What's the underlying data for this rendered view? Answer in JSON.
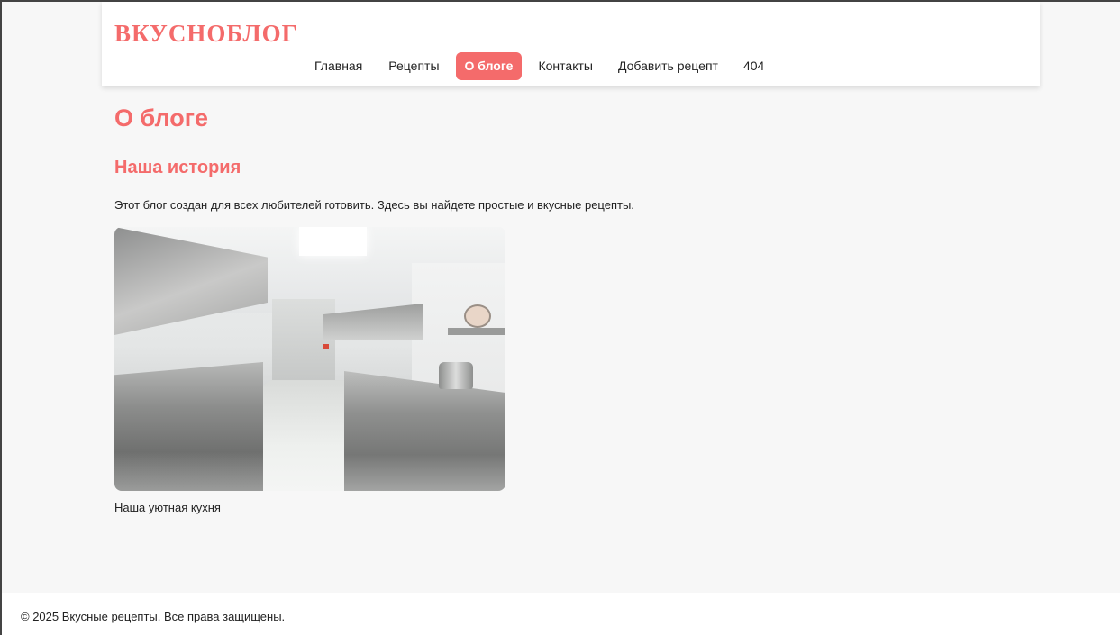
{
  "header": {
    "logo": "ВКУСНОБЛОГ",
    "nav": [
      {
        "label": "Главная",
        "active": false
      },
      {
        "label": "Рецепты",
        "active": false
      },
      {
        "label": "О блоге",
        "active": true
      },
      {
        "label": "Контакты",
        "active": false
      },
      {
        "label": "Добавить рецепт",
        "active": false
      },
      {
        "label": "404",
        "active": false
      }
    ]
  },
  "main": {
    "title": "О блоге",
    "section_title": "Наша история",
    "intro": "Этот блог создан для всех любителей готовить. Здесь вы найдете простые и вкусные рецепты.",
    "caption": "Наша уютная кухня"
  },
  "footer": {
    "text": "© 2025 Вкусные рецепты. Все права защищены."
  },
  "colors": {
    "accent": "#f46b6b",
    "background": "#f7f7f7",
    "header_bg": "#ffffff"
  }
}
